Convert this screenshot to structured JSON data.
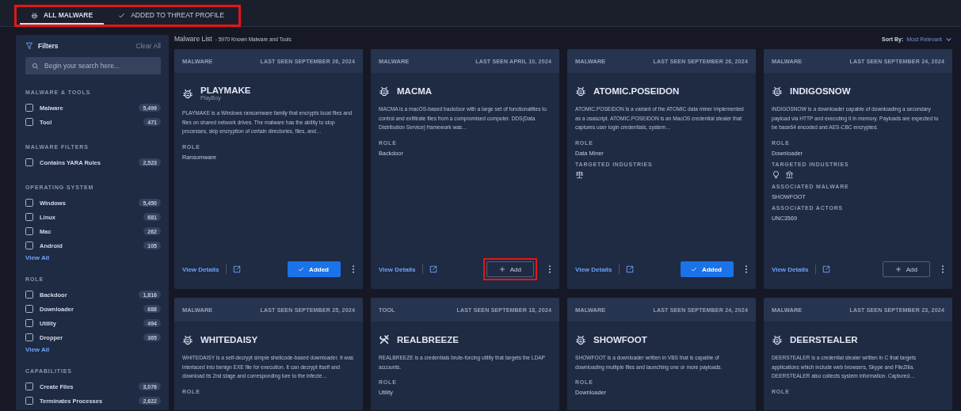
{
  "tabs": {
    "highlighted": true,
    "items": [
      {
        "label": "ALL MALWARE",
        "kind": "malware",
        "selected": true
      },
      {
        "label": "ADDED TO THREAT PROFILE",
        "kind": "check",
        "selected": false
      }
    ]
  },
  "filters": {
    "title": "Filters",
    "clear": "Clear All",
    "search": {
      "placeholder": "Begin your search here..."
    },
    "groups": [
      {
        "title": "MALWARE & TOOLS",
        "options": [
          {
            "label": "Malware",
            "count": "5,499",
            "checked": false
          },
          {
            "label": "Tool",
            "count": "471",
            "checked": false
          }
        ]
      },
      {
        "title": "MALWARE FILTERS",
        "options": [
          {
            "label": "Contains YARA Rules",
            "count": "2,523",
            "checked": false
          }
        ]
      },
      {
        "title": "OPERATING SYSTEM",
        "options": [
          {
            "label": "Windows",
            "count": "5,450",
            "checked": false
          },
          {
            "label": "Linux",
            "count": "681",
            "checked": false
          },
          {
            "label": "Mac",
            "count": "262",
            "checked": false
          },
          {
            "label": "Android",
            "count": "105",
            "checked": false
          }
        ],
        "more": "View All"
      },
      {
        "title": "ROLE",
        "options": [
          {
            "label": "Backdoor",
            "count": "1,816",
            "checked": false
          },
          {
            "label": "Downloader",
            "count": "688",
            "checked": false
          },
          {
            "label": "Utility",
            "count": "494",
            "checked": false
          },
          {
            "label": "Dropper",
            "count": "365",
            "checked": false
          }
        ],
        "more": "View All"
      },
      {
        "title": "CAPABILITIES",
        "options": [
          {
            "label": "Create Files",
            "count": "3,076",
            "checked": false
          },
          {
            "label": "Terminates Processes",
            "count": "2,622",
            "checked": false
          }
        ]
      }
    ]
  },
  "list_header": {
    "title": "Malware List",
    "subtitle": "- 5970 Known Malware and Tools",
    "sort_label": "Sort By:",
    "sort_value": "Most Relevant"
  },
  "cards": [
    {
      "kind": "malware",
      "type": "MALWARE",
      "last_seen": "LAST SEEN SEPTEMBER 26, 2024",
      "name": "PLAYMAKE",
      "alias": "PlayBoy",
      "description": "PLAYMAKE is a Windows ransomware family that encrypts local files and files on shared network drives. The malware has the ability to stop processes, skip encryption of certain directories, files, and…",
      "details": [
        {
          "label": "ROLE",
          "value": "Ransomware"
        }
      ],
      "link": "View Details",
      "button": "Added",
      "added": true,
      "highlighted": false
    },
    {
      "kind": "malware",
      "type": "MALWARE",
      "last_seen": "LAST SEEN APRIL 10, 2024",
      "name": "MACMA",
      "description": "MACMA is a macOS-based backdoor with a large set of functionalities to control and exfiltrate files from a compromised computer. DDS(Data Distribution Service) framework was…",
      "details": [
        {
          "label": "ROLE",
          "value": "Backdoor"
        }
      ],
      "link": "View Details",
      "button": "Add",
      "added": false,
      "highlighted": true
    },
    {
      "kind": "malware",
      "type": "MALWARE",
      "last_seen": "LAST SEEN SEPTEMBER 26, 2024",
      "name": "ATOMIC.POSEIDON",
      "description": "ATOMIC.POSEIDON is a variant of the ATOMIC data miner implemented as a osascript. ATOMIC.POSEIDON is an MacOS credential stealer that captures user login credentials, system…",
      "details": [
        {
          "label": "ROLE",
          "value": "Data Miner"
        },
        {
          "label": "TARGETED INDUSTRIES",
          "icons": [
            {
              "kind": "scale"
            }
          ]
        }
      ],
      "link": "View Details",
      "button": "Added",
      "added": true,
      "highlighted": false
    },
    {
      "kind": "malware",
      "type": "MALWARE",
      "last_seen": "LAST SEEN SEPTEMBER 24, 2024",
      "name": "INDIGOSNOW",
      "description": "INDIGOSNOW is a downloader capable of downloading a secondary payload via HTTP and executing it in memory. Payloads are expected to be base64 encoded and AES-CBC encrypted.",
      "details": [
        {
          "label": "ROLE",
          "value": "Downloader"
        },
        {
          "label": "TARGETED INDUSTRIES",
          "icons": [
            {
              "kind": "bulb"
            },
            {
              "kind": "bank"
            }
          ]
        },
        {
          "label": "ASSOCIATED MALWARE",
          "value": "SHOWFOOT"
        },
        {
          "label": "ASSOCIATED ACTORS",
          "value": "UNC3569"
        }
      ],
      "link": "View Details",
      "button": "Add",
      "added": false,
      "highlighted": false
    },
    {
      "kind": "malware",
      "type": "MALWARE",
      "last_seen": "LAST SEEN SEPTEMBER 25, 2024",
      "name": "WHITEDAISY",
      "description": "WHITEDAISY is a self-decrypt simple shellcode-based downloader. It was interlaced into benign EXE file for execution. It can decrypt itself and download its 2nd stage and corresponding lure to the infecte…",
      "details": [
        {
          "label": "ROLE"
        }
      ]
    },
    {
      "kind": "tool",
      "type": "TOOL",
      "last_seen": "LAST SEEN SEPTEMBER 18, 2024",
      "name": "REALBREEZE",
      "description": "REALBREEZE is a credentials brute-forcing utility that targets the LDAP accounts.",
      "details": [
        {
          "label": "ROLE",
          "value": "Utility"
        }
      ]
    },
    {
      "kind": "malware",
      "type": "MALWARE",
      "last_seen": "LAST SEEN SEPTEMBER 24, 2024",
      "name": "SHOWFOOT",
      "description": "SHOWFOOT is a downloader written in VBS that is capable of downloading multiple files and launching one or more payloads.",
      "details": [
        {
          "label": "ROLE",
          "value": "Downloader"
        }
      ]
    },
    {
      "kind": "malware",
      "type": "MALWARE",
      "last_seen": "LAST SEEN SEPTEMBER 23, 2024",
      "name": "DEERSTEALER",
      "description": "DEERSTEALER is a credential stealer written in C that targets applications which include web browsers, Skype and FileZilla. DEERSTEALER also collects system information. Captured…",
      "details": [
        {
          "label": "ROLE"
        }
      ]
    }
  ]
}
